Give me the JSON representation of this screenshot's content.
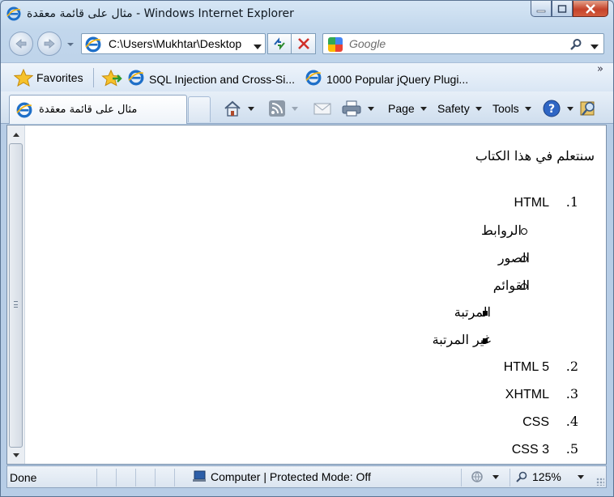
{
  "window": {
    "title": "مثال على قائمة معقدة - Windows Internet Explorer"
  },
  "address_bar": {
    "url": "C:\\Users\\Mukhtar\\Desktop"
  },
  "search": {
    "placeholder": "Google"
  },
  "favorites_bar": {
    "favorites_label": "Favorites",
    "links": [
      {
        "label": "SQL Injection and Cross-Si..."
      },
      {
        "label": "1000 Popular jQuery Plugi..."
      }
    ],
    "overflow": "»"
  },
  "tab": {
    "title": "مثال على قائمة معقدة"
  },
  "command_bar": {
    "page_label": "Page",
    "safety_label": "Safety",
    "tools_label": "Tools"
  },
  "page": {
    "intro": "سنتعلم في هذا الكتاب",
    "ordered_list": [
      {
        "number": "1.",
        "text": "HTML"
      },
      {
        "number": "2.",
        "text": "HTML 5"
      },
      {
        "number": "3.",
        "text": "XHTML"
      },
      {
        "number": "4.",
        "text": "CSS"
      },
      {
        "number": "5.",
        "text": "CSS 3"
      }
    ],
    "html_sublist": [
      "الروابط",
      "الصور",
      "القوائم"
    ],
    "lists_sublist": [
      "المرتبة",
      "غير المرتبة"
    ]
  },
  "status_bar": {
    "status": "Done",
    "zone": "Computer | Protected Mode: Off",
    "zoom": "125%"
  },
  "colors": {
    "frame": "#b7cde6",
    "close_button": "#c5432b",
    "ie_blue": "#1e6fc8"
  }
}
